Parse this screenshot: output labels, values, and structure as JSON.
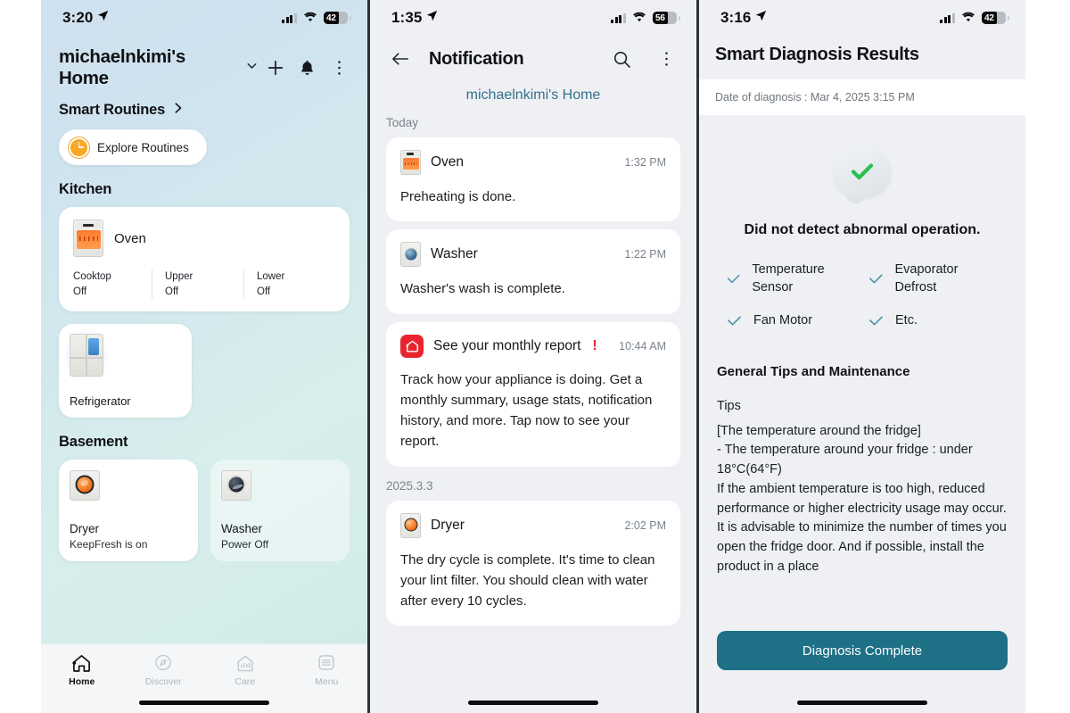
{
  "panel1": {
    "status": {
      "time": "3:20",
      "battery": "42"
    },
    "header": {
      "home_name": "michaelnkimi's Home",
      "add_label": "+",
      "bell": "bell-icon",
      "more": "more-icon"
    },
    "smart_routines": {
      "label": "Smart Routines",
      "explore_label": "Explore Routines"
    },
    "sections": [
      {
        "title": "Kitchen"
      },
      {
        "title": "Basement"
      }
    ],
    "oven_card": {
      "name": "Oven",
      "stats": [
        {
          "key": "Cooktop",
          "value": "Off"
        },
        {
          "key": "Upper",
          "value": "Off"
        },
        {
          "key": "Lower",
          "value": "Off"
        }
      ]
    },
    "fridge_card": {
      "name": "Refrigerator"
    },
    "basement_tiles": [
      {
        "name": "Dryer",
        "sub": "KeepFresh is on"
      },
      {
        "name": "Washer",
        "sub": "Power Off"
      }
    ],
    "tabs": [
      {
        "label": "Home",
        "icon": "home-icon"
      },
      {
        "label": "Discover",
        "icon": "compass-icon"
      },
      {
        "label": "Care",
        "icon": "care-icon"
      },
      {
        "label": "Menu",
        "icon": "menu-icon"
      }
    ]
  },
  "panel2": {
    "status": {
      "time": "1:35",
      "battery": "56"
    },
    "header": {
      "title": "Notification",
      "back": "back-arrow-icon",
      "search": "search-icon",
      "more": "more-icon"
    },
    "home_link": "michaelnkimi's Home",
    "groups": [
      {
        "label": "Today"
      },
      {
        "label": "2025.3.3"
      }
    ],
    "notifications": [
      {
        "app": "Oven",
        "time": "1:32 PM",
        "body": "Preheating is done.",
        "icon": "oven-icon",
        "alert": false
      },
      {
        "app": "Washer",
        "time": "1:22 PM",
        "body": "Washer's wash is complete.",
        "icon": "washer-icon",
        "alert": false
      },
      {
        "app": "See your monthly report",
        "time": "10:44 AM",
        "body": "Track how your appliance is doing. Get a monthly summary, usage stats, notification history, and more. Tap now to see your report.",
        "icon": "lg-thinq-icon",
        "alert": true
      },
      {
        "app": "Dryer",
        "time": "2:02 PM",
        "body": "The dry cycle is complete. It's time to clean your lint filter. You should clean with water after every 10 cycles.",
        "icon": "dryer-icon",
        "alert": false
      }
    ]
  },
  "panel3": {
    "status": {
      "time": "3:16",
      "battery": "42"
    },
    "title": "Smart Diagnosis Results",
    "date_line": "Date of diagnosis : Mar 4, 2025 3:15 PM",
    "result_icon": "green-check-bubble-icon",
    "result_title": "Did not detect abnormal operation.",
    "checks": [
      "Temperature Sensor",
      "Evaporator Defrost",
      "Fan Motor",
      "Etc."
    ],
    "tips_heading": "General Tips and Maintenance",
    "tips_subheading": "Tips",
    "tips_body": "[The temperature around the fridge]\n - The temperature around your fridge : under 18°C(64°F)\nIf the ambient temperature is too high, reduced performance or higher electricity usage may occur. It is advisable to minimize the number of times you open the fridge door. And if possible, install the product in a place",
    "cta_label": "Diagnosis Complete",
    "accent_color": "#1d7086"
  }
}
